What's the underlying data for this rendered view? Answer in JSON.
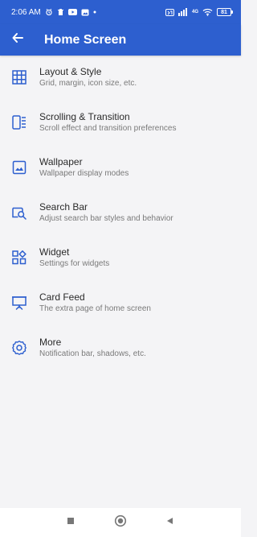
{
  "status_bar": {
    "time": "2:06 AM",
    "network_label": "4G",
    "battery": "81"
  },
  "app_bar": {
    "title": "Home Screen"
  },
  "settings": [
    {
      "title": "Layout & Style",
      "description": "Grid, margin, icon size, etc.",
      "icon": "grid-icon"
    },
    {
      "title": "Scrolling & Transition",
      "description": "Scroll effect and transition preferences",
      "icon": "transition-icon"
    },
    {
      "title": "Wallpaper",
      "description": "Wallpaper display modes",
      "icon": "wallpaper-icon"
    },
    {
      "title": "Search Bar",
      "description": "Adjust search bar styles and behavior",
      "icon": "search-bar-icon"
    },
    {
      "title": "Widget",
      "description": "Settings for widgets",
      "icon": "widget-icon"
    },
    {
      "title": "Card Feed",
      "description": "The extra page of home screen",
      "icon": "card-feed-icon"
    },
    {
      "title": "More",
      "description": "Notification bar, shadows, etc.",
      "icon": "settings-gear-icon"
    }
  ],
  "colors": {
    "primary": "#2d5fcf",
    "background": "#f4f4f6",
    "title_text": "#2b2b2b",
    "secondary_text": "#7a7a7a",
    "nav_icon": "#777777"
  }
}
